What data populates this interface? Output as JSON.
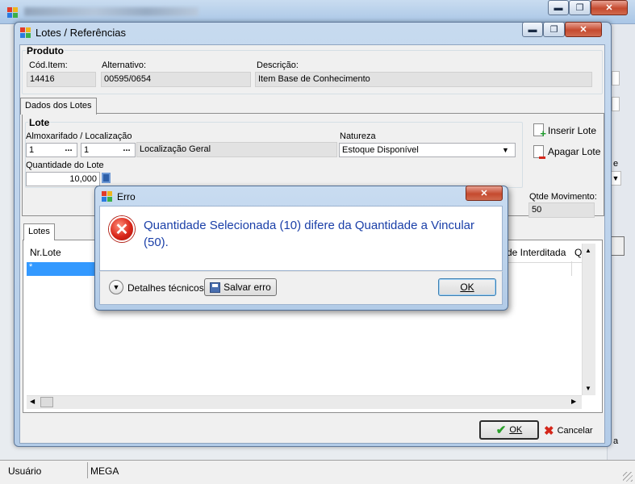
{
  "main_window": {
    "statusbar": {
      "user_label": "Usuário",
      "user_value": "MEGA"
    },
    "right_fragments": [
      "e",
      "a"
    ]
  },
  "lotes_dialog": {
    "title": "Lotes / Referências",
    "produto": {
      "section_label": "Produto",
      "cod_item_label": "Cód.Item:",
      "cod_item_value": "14416",
      "alternativo_label": "Alternativo:",
      "alternativo_value": "00595/0654",
      "descricao_label": "Descrição:",
      "descricao_value": "Item Base de Conhecimento"
    },
    "tab_label": "Dados dos Lotes",
    "lote": {
      "section_label": "Lote",
      "almox_label": "Almoxarifado / Localização",
      "almox_value": "1",
      "localizacao_value": "1",
      "localizacao_desc": "Localização Geral",
      "ellipsis": "...",
      "natureza_label": "Natureza",
      "natureza_value": "Estoque Disponível",
      "quantidade_label": "Quantidade do Lote",
      "quantidade_value": "10,000"
    },
    "inserir_lote": "Inserir Lote",
    "apagar_lote": "Apagar Lote",
    "qtde_movimento_label": "Qtde Movimento:",
    "qtde_movimento_value": "50",
    "lotes_tab_label": "Lotes",
    "grid": {
      "col_nr_lote": "Nr.Lote",
      "col_interditada": "de Interditada",
      "col_q": "Q",
      "new_row_marker": "*"
    },
    "ok_button": "OK",
    "cancelar_button": "Cancelar"
  },
  "error_dialog": {
    "title": "Erro",
    "message": "Quantidade Selecionada (10) difere da Quantidade a Vincular (50).",
    "details_label": "Detalhes técnicos",
    "salvar_erro_button": "Salvar erro",
    "ok_button": "OK",
    "colors": {
      "message": "#1a3fa8",
      "icon": "#d9261a"
    }
  }
}
